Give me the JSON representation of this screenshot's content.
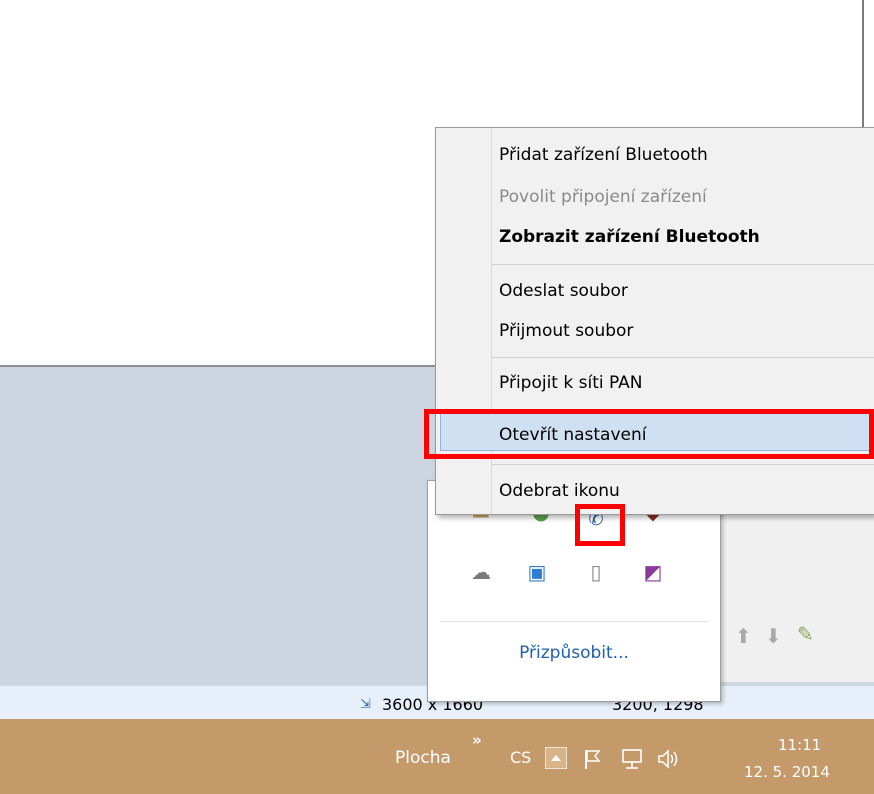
{
  "context_menu": {
    "items": [
      {
        "label": "Přidat zařízení Bluetooth",
        "state": "normal"
      },
      {
        "label": "Povolit připojení zařízení",
        "state": "disabled"
      },
      {
        "label": "Zobrazit zařízení Bluetooth",
        "state": "bold"
      },
      {
        "label": "Odeslat soubor",
        "state": "normal"
      },
      {
        "label": "Přijmout soubor",
        "state": "normal"
      },
      {
        "label": "Připojit k síti PAN",
        "state": "normal"
      },
      {
        "label": "Otevřít nastavení",
        "state": "highlighted"
      },
      {
        "label": "Odebrat ikonu",
        "state": "normal"
      }
    ]
  },
  "flyout": {
    "customize_label": "Přizpůsobit...",
    "icons": [
      "onedrive-icon",
      "photo-upload-icon",
      "phone-icon",
      "onenote-icon",
      "bluetooth-icon"
    ]
  },
  "statusbar": {
    "left_text": "3600 x 1660",
    "right_text": "3200, 1298"
  },
  "taskbar": {
    "desktop_label": "Plocha",
    "chevron": "»",
    "language": "CS",
    "time": "11:11",
    "date": "12. 5. 2014"
  },
  "colors": {
    "highlight": "#cfe0f2",
    "annotation": "#ff0000",
    "taskbar": "#c59a6a",
    "link": "#1f5fae"
  }
}
